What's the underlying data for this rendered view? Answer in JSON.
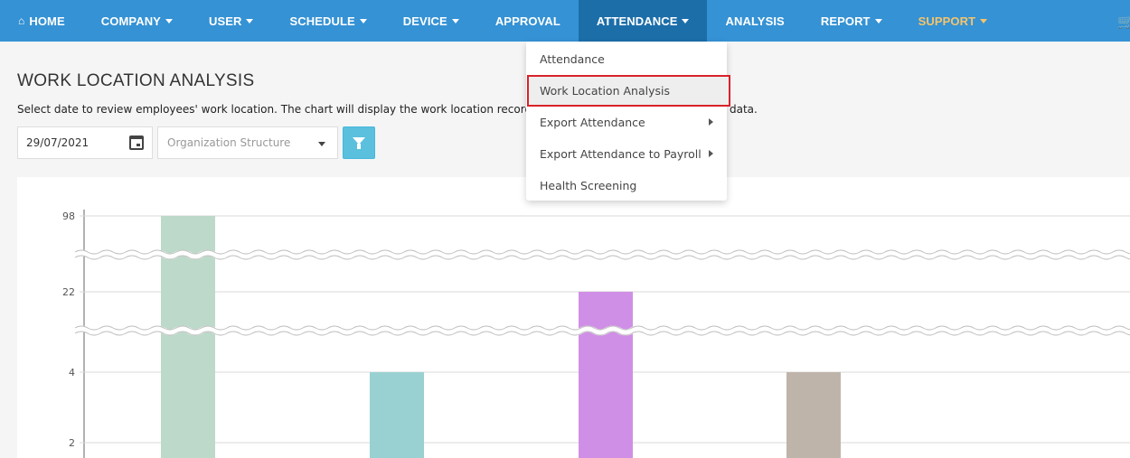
{
  "nav": {
    "items": [
      {
        "label": "HOME",
        "icon": "home-icon",
        "caret": false
      },
      {
        "label": "COMPANY",
        "caret": true
      },
      {
        "label": "USER",
        "caret": true
      },
      {
        "label": "SCHEDULE",
        "caret": true
      },
      {
        "label": "DEVICE",
        "caret": true
      },
      {
        "label": "APPROVAL",
        "caret": false
      },
      {
        "label": "ATTENDANCE",
        "caret": true,
        "active": true
      },
      {
        "label": "ANALYSIS",
        "caret": false
      },
      {
        "label": "REPORT",
        "caret": true
      },
      {
        "label": "SUPPORT",
        "caret": true,
        "highlight_color": "#f5c46b"
      }
    ],
    "background": "#3592d4",
    "active_background": "#1c6ea9"
  },
  "dropdown": {
    "items": [
      {
        "label": "Attendance",
        "submenu": false
      },
      {
        "label": "Work Location Analysis",
        "submenu": false,
        "highlighted": true
      },
      {
        "label": "Export Attendance",
        "submenu": true
      },
      {
        "label": "Export Attendance to Payroll",
        "submenu": true
      },
      {
        "label": "Health Screening",
        "submenu": false
      }
    ]
  },
  "page": {
    "title": "WORK LOCATION ANALYSIS",
    "description_visible": "Select date to review employees' work location. The chart will display the work location records b",
    "description_tail": "data."
  },
  "filters": {
    "date_value": "29/07/2021",
    "org_placeholder": "Organization Structure"
  },
  "chart_data": {
    "type": "bar",
    "y_scale": "broken",
    "y_ticks": [
      "98",
      "22",
      "4",
      "2"
    ],
    "values": [
      98,
      4,
      22,
      4
    ],
    "colors": [
      "#bcd9c9",
      "#99d1d2",
      "#d08fe6",
      "#beb4aa"
    ]
  }
}
